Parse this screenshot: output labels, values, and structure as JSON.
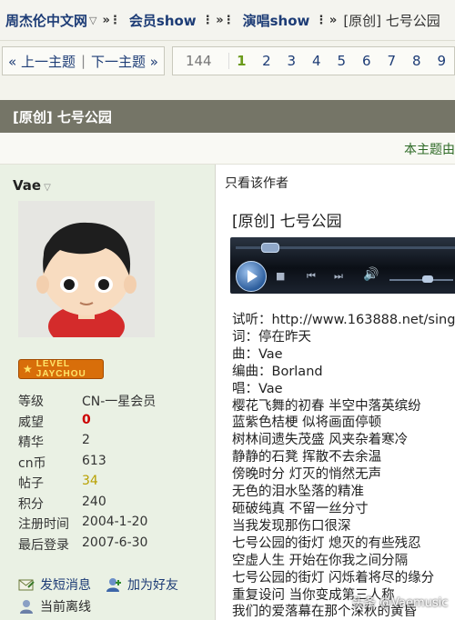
{
  "breadcrumb": {
    "items": [
      {
        "label": "周杰伦中文网"
      },
      {
        "label": "会员show"
      },
      {
        "label": "演唱show"
      }
    ],
    "current": "[原创] 七号公园"
  },
  "thread_nav": {
    "prev_label": "« 上一主题",
    "next_label": "下一主题 »"
  },
  "pagination": {
    "total": "144",
    "current_page": "1",
    "pages": [
      "1",
      "2",
      "3",
      "4",
      "5",
      "6",
      "7",
      "8",
      "9"
    ]
  },
  "thread": {
    "title": "[原创] 七号公园",
    "moderation_link": "本主题由"
  },
  "author": {
    "name": "Vae",
    "badge_text": "LEVEL JAYCHOU",
    "stats": [
      {
        "label": "等级",
        "value": "CN-一星会员"
      },
      {
        "label": "威望",
        "value": "0"
      },
      {
        "label": "精华",
        "value": "2"
      },
      {
        "label": "cn币",
        "value": "613"
      },
      {
        "label": "帖子",
        "value": "34"
      },
      {
        "label": "积分",
        "value": "240"
      },
      {
        "label": "注册时间",
        "value": "2004-1-20"
      },
      {
        "label": "最后登录",
        "value": "2007-6-30"
      }
    ],
    "send_message_label": "发短消息",
    "add_friend_label": "加为好友",
    "online_status": "当前离线"
  },
  "post": {
    "only_author_label": "只看该作者",
    "title": "[原创] 七号公园",
    "lines": [
      "试听：http://www.163888.net/sing",
      "词：停在昨天",
      "曲：Vae",
      "编曲：Borland",
      "唱：Vae",
      "樱花飞舞的初春 半空中落英缤纷",
      "蓝紫色桔梗 似将画面停顿",
      "树林间遗失茂盛 风夹杂着寒冷",
      "静静的石凳 挥散不去余温",
      "傍晚时分 灯灭的悄然无声",
      "无色的泪水坠落的精准",
      "砸破纯真 不留一丝分寸",
      "当我发现那伤口很深",
      "七号公园的街灯 熄灭的有些残忍",
      "空虚人生 开始在你我之间分隔",
      "七号公园的街灯 闪烁着将尽的缘分",
      "重复设问 当你变成第三人称",
      "我们的爱落幕在那个深秋的黄昏"
    ]
  },
  "watermark": "头条 @Vaemusic",
  "colors": {
    "title_bar": "#757567",
    "link": "#1d3c76",
    "current_page": "#6a9a1a",
    "left_column_bg": "#eaf1e4"
  }
}
